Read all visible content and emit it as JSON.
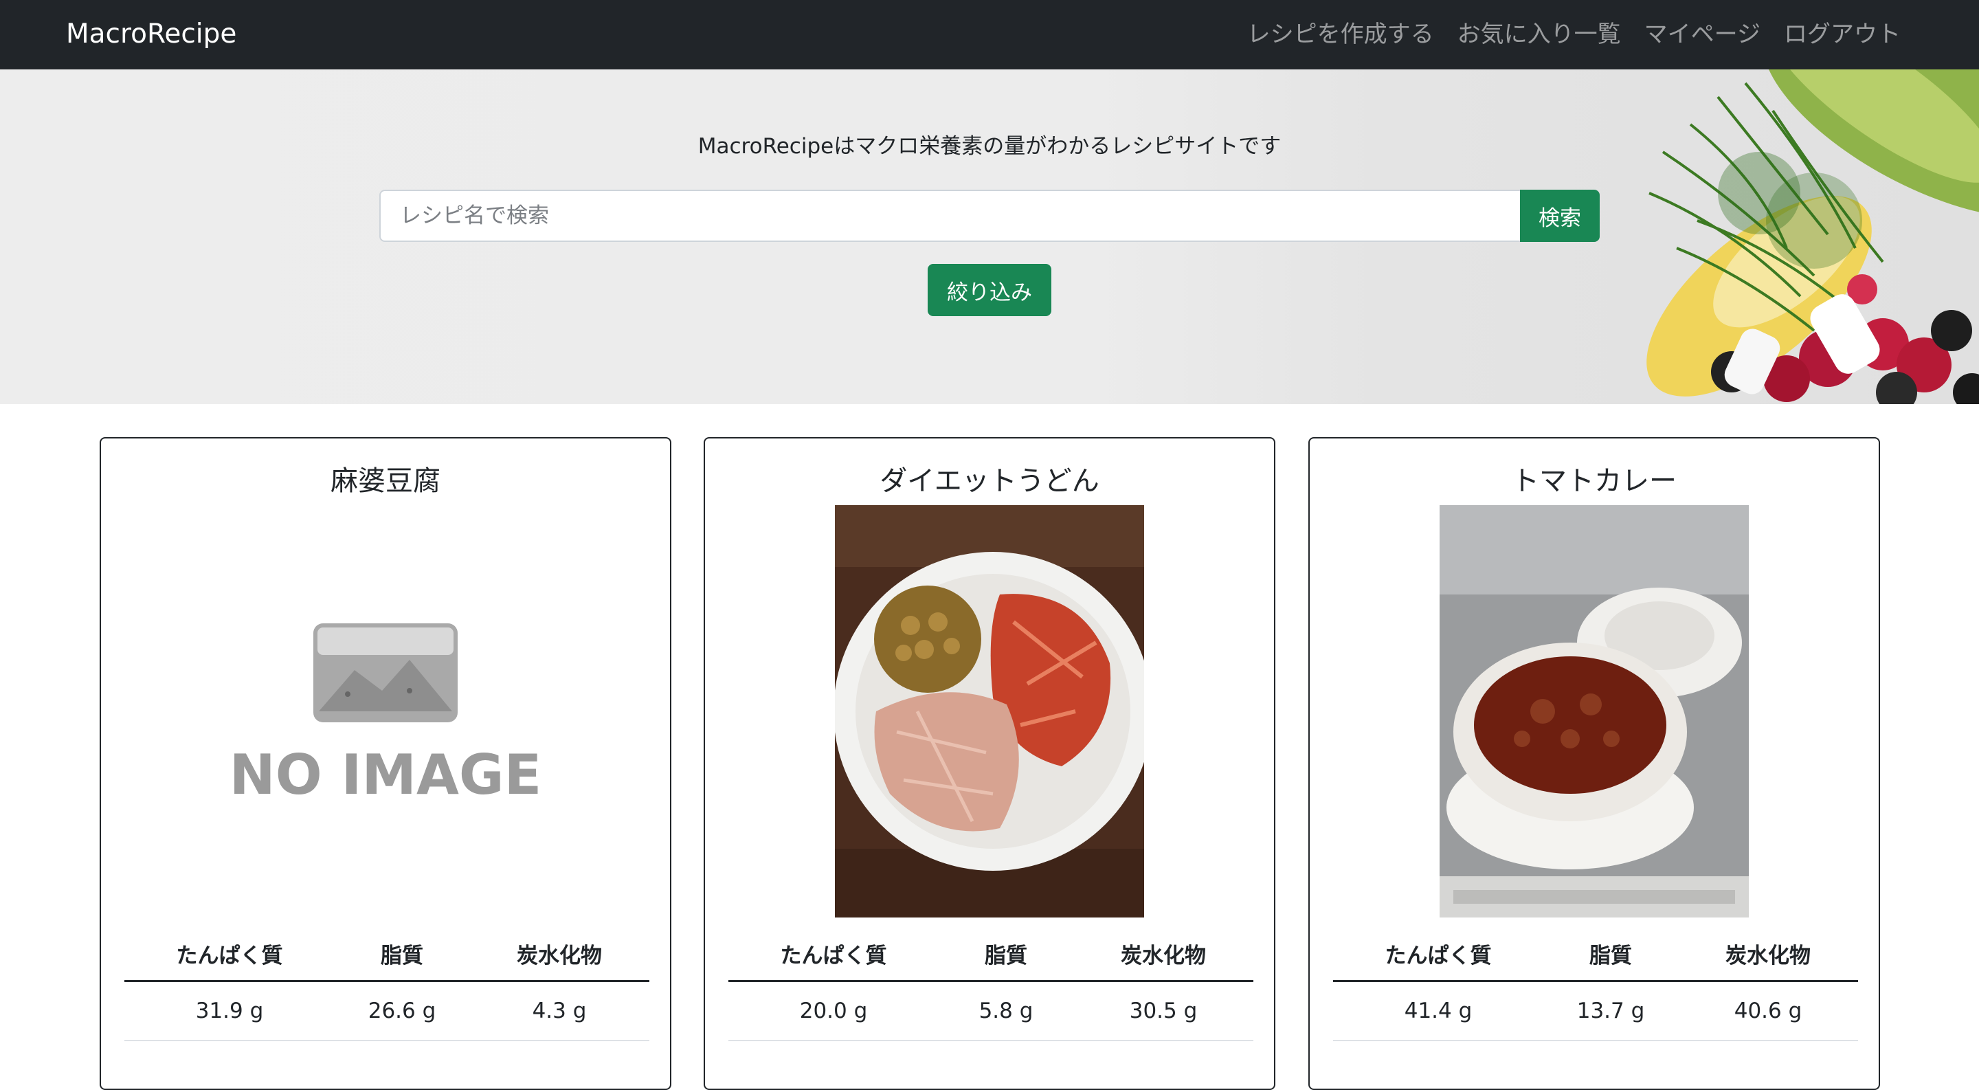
{
  "navbar": {
    "brand": "MacroRecipe",
    "links": [
      "レシピを作成する",
      "お気に入り一覧",
      "マイページ",
      "ログアウト"
    ]
  },
  "hero": {
    "tagline": "MacroRecipeはマクロ栄養素の量がわかるレシピサイトです",
    "search_placeholder": "レシピ名で検索",
    "search_button": "検索",
    "filter_button": "絞り込み"
  },
  "table_headers": [
    "たんぱく質",
    "脂質",
    "炭水化物"
  ],
  "recipes": [
    {
      "title": "麻婆豆腐",
      "image": "no-image-placeholder",
      "no_image_text": "NO IMAGE",
      "protein": "31.9 g",
      "fat": "26.6 g",
      "carbs": "4.3 g"
    },
    {
      "title": "ダイエットうどん",
      "image": "udon-bowl-photo",
      "protein": "20.0 g",
      "fat": "5.8 g",
      "carbs": "30.5 g"
    },
    {
      "title": "トマトカレー",
      "image": "tomato-curry-photo",
      "protein": "41.4 g",
      "fat": "13.7 g",
      "carbs": "40.6 g"
    }
  ]
}
